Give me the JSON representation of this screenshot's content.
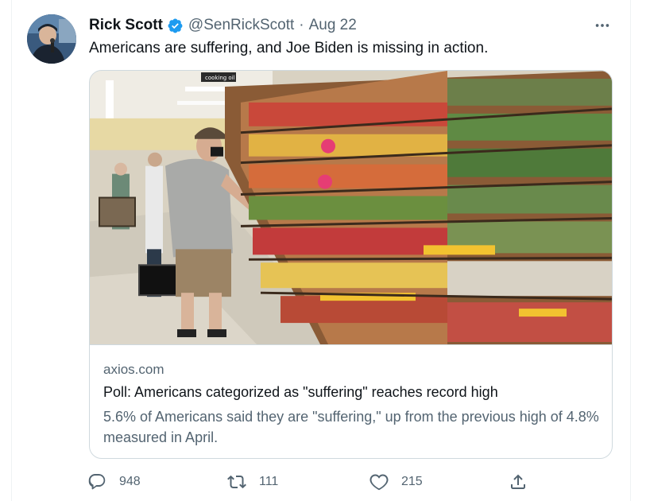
{
  "tweet": {
    "author_name": "Rick Scott",
    "handle": "@SenRickScott",
    "separator": "·",
    "date": "Aug 22",
    "text": "Americans are suffering, and Joe Biden is missing in action.",
    "more_icon": "more-dots-icon"
  },
  "card": {
    "image_sign": "cooking oil",
    "domain": "axios.com",
    "title": "Poll: Americans categorized as \"suffering\" reaches record high",
    "description": "5.6% of Americans said they are \"suffering,\" up from the previous high of 4.8% measured in April."
  },
  "actions": {
    "reply_count": "948",
    "retweet_count": "111",
    "like_count": "215",
    "icons": [
      "reply-icon",
      "retweet-icon",
      "like-icon",
      "share-icon"
    ]
  },
  "colors": {
    "verified": "#1d9bf0",
    "secondary_text": "#536471",
    "border": "#cfd9de"
  }
}
